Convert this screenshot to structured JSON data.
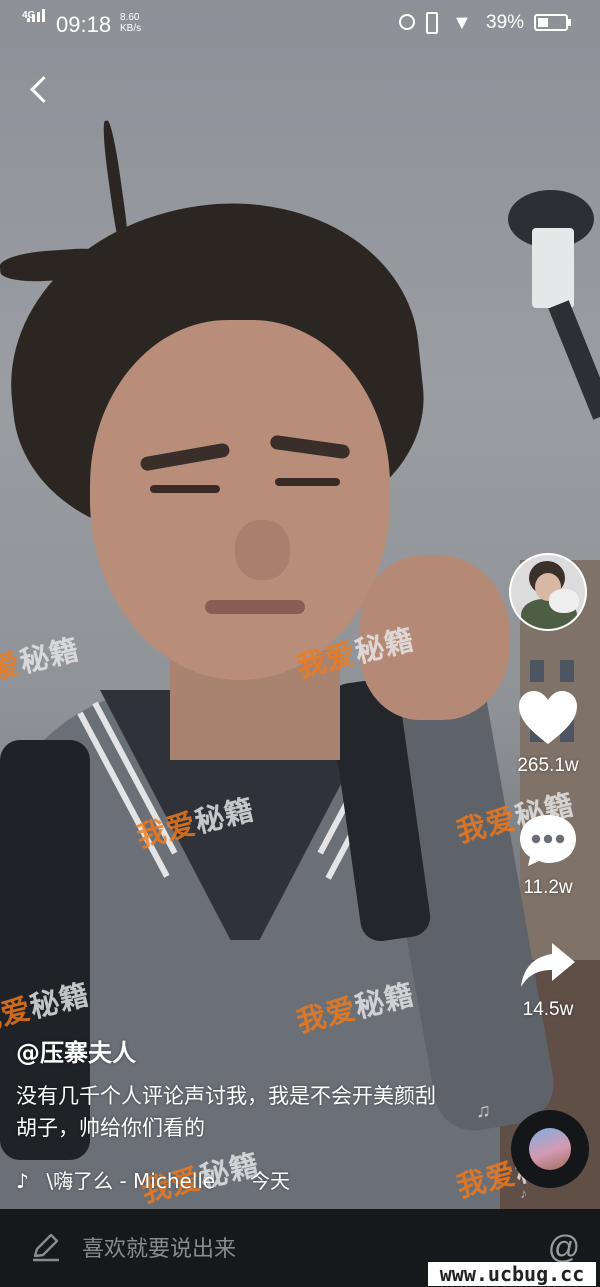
{
  "status_bar": {
    "network": "4G",
    "time": "09:18",
    "speed_value": "8.60",
    "speed_unit": "KB/s",
    "battery": "39%",
    "battery_level": 0.39
  },
  "video": {
    "author": "@压寨夫人",
    "description": "没有几千个人评论声讨我，我是不会开美颜刮胡子，帅给你们看的",
    "music": "\\嗨了么 - Michelle",
    "date": "今天"
  },
  "actions": {
    "likes": "265.1w",
    "comments": "11.2w",
    "shares": "14.5w"
  },
  "comment_bar": {
    "placeholder": "喜欢就要说出来",
    "at_symbol": "@"
  },
  "watermarks": {
    "part_a": "我爱",
    "part_b": "秘籍",
    "site": "www.ucbug.cc"
  },
  "icons": {
    "back": "chevron-left",
    "like": "heart",
    "comment": "speech-bubble",
    "share": "share-arrow",
    "music": "tiktok-note",
    "edit": "pencil",
    "colors": {
      "accent_watermark": "#f07a1c",
      "text": "#ffffff",
      "bar_bg": "#17181b"
    }
  }
}
